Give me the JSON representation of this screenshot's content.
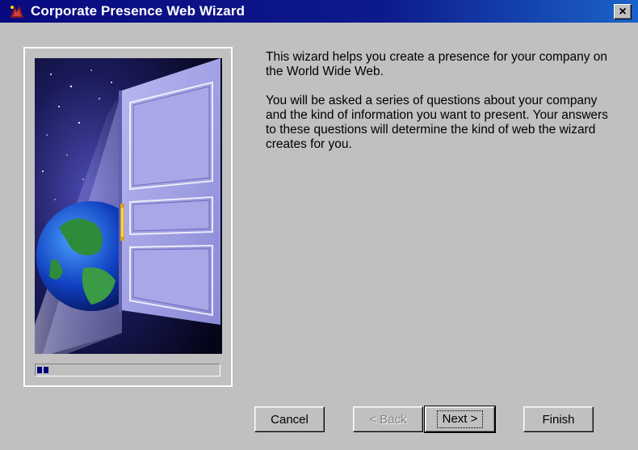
{
  "window": {
    "title": "Corporate Presence Web Wizard",
    "close_label": "×"
  },
  "intro": {
    "paragraph1": "This wizard helps you create a presence for your company on the World Wide Web.",
    "paragraph2": "You will be asked a series of questions about your company and the kind of information you want to present. Your answers to these questions will determine the kind of web the wizard creates for you."
  },
  "progress": {
    "fraction": 0.05
  },
  "buttons": {
    "cancel": "Cancel",
    "back": "< Back",
    "next": "Next >",
    "finish": "Finish"
  },
  "colors": {
    "titlebar_start": "#0a0a80",
    "titlebar_end": "#1a63c8",
    "face": "#c0c0c0",
    "progress": "#000080"
  },
  "icons": {
    "app": "wizard-app-icon",
    "close": "close-icon"
  }
}
